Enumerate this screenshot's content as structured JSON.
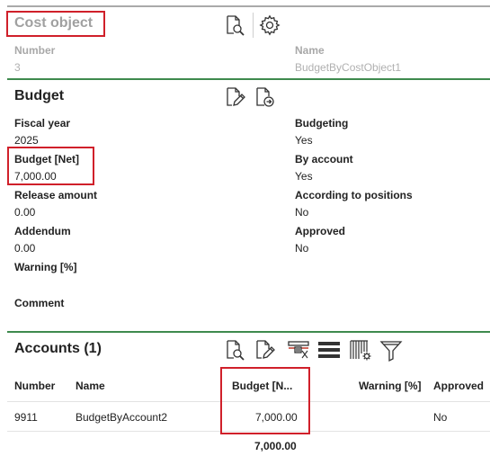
{
  "cost_object": {
    "title": "Cost object",
    "number_label": "Number",
    "number_value": "3",
    "name_label": "Name",
    "name_value": "BudgetByCostObject1"
  },
  "budget": {
    "title": "Budget",
    "fiscal_year_label": "Fiscal year",
    "fiscal_year_value": "2025",
    "budget_net_label": "Budget [Net]",
    "budget_net_value": "7,000.00",
    "release_amount_label": "Release amount",
    "release_amount_value": "0.00",
    "addendum_label": "Addendum",
    "addendum_value": "0.00",
    "warning_label": "Warning [%]",
    "comment_label": "Comment",
    "budgeting_label": "Budgeting",
    "budgeting_value": "Yes",
    "by_account_label": "By account",
    "by_account_value": "Yes",
    "according_label": "According to positions",
    "according_value": "No",
    "approved_label": "Approved",
    "approved_value": "No"
  },
  "accounts": {
    "title": "Accounts (1)",
    "columns": {
      "number": "Number",
      "name": "Name",
      "budget": "Budget [N...",
      "warning": "Warning [%]",
      "approved": "Approved"
    },
    "rows": [
      {
        "number": "9911",
        "name": "BudgetByAccount2",
        "budget": "7,000.00",
        "warning": "",
        "approved": "No"
      }
    ],
    "total": "7,000.00"
  },
  "icons": {
    "cost_object": [
      "document-search-icon",
      "gear-icon"
    ],
    "budget": [
      "document-edit-icon",
      "document-export-icon"
    ],
    "accounts": [
      "document-search-icon",
      "document-edit-icon",
      "column-layout-icon",
      "list-lines-icon",
      "barcode-settings-icon",
      "filter-icon"
    ]
  },
  "colors": {
    "accent_green": "#3e8a4e",
    "highlight_red": "#d0202a"
  }
}
